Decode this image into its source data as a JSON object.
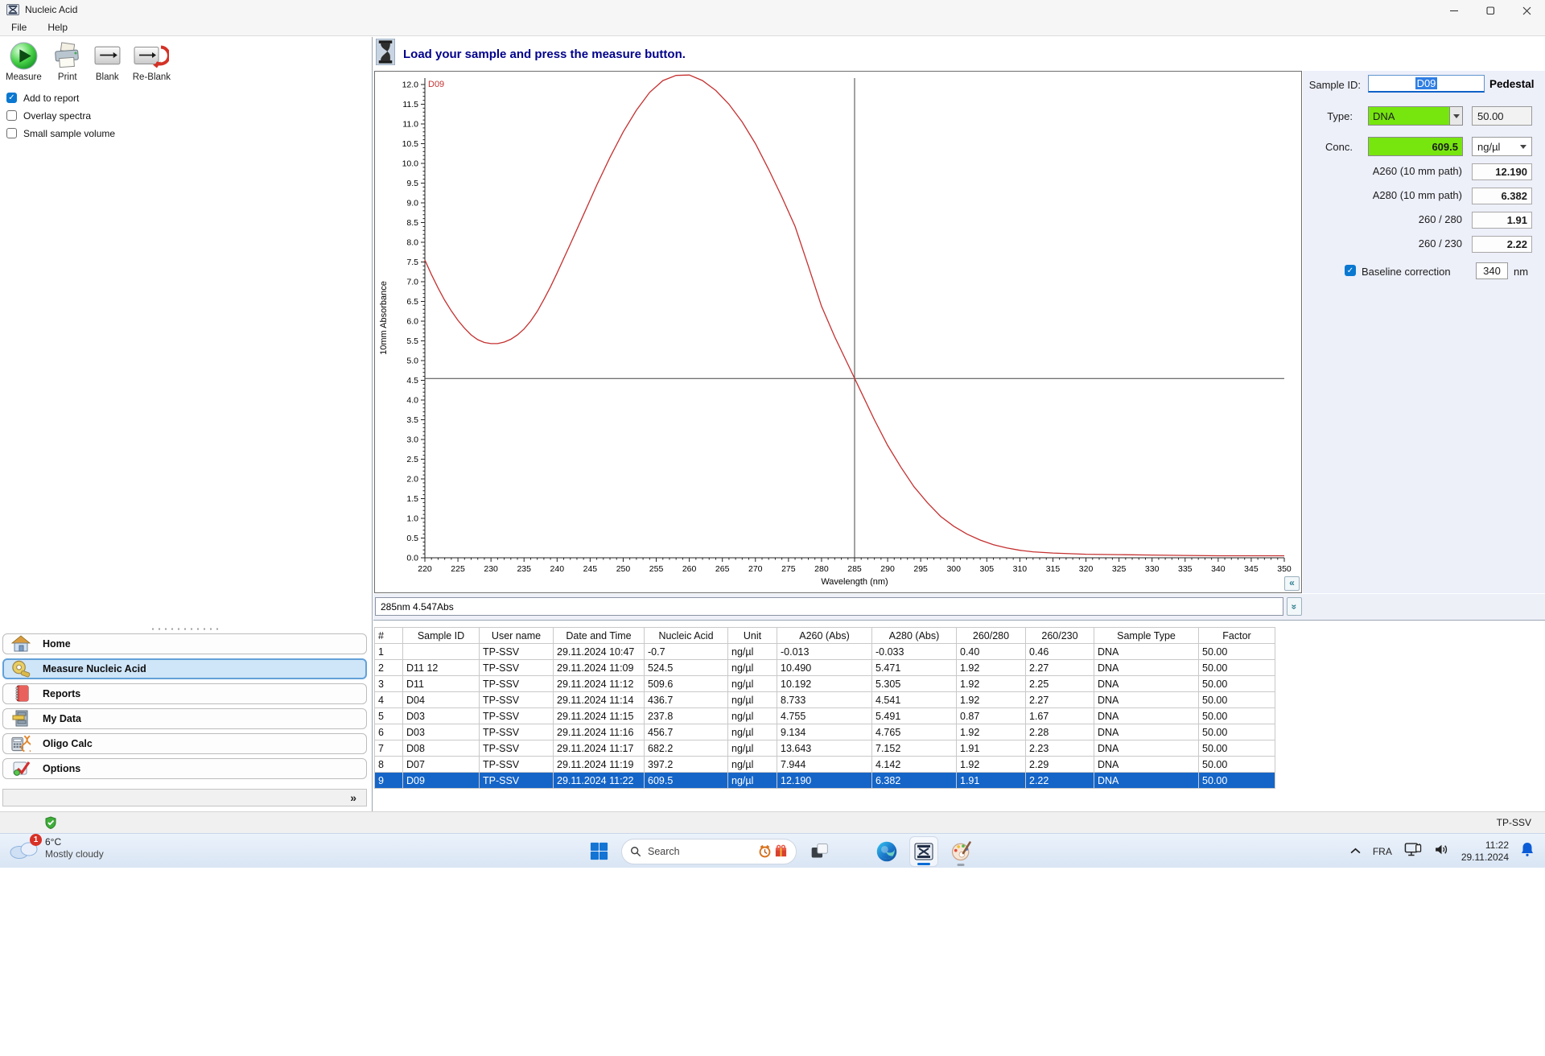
{
  "window": {
    "title": "Nucleic Acid"
  },
  "menu": {
    "items": [
      "File",
      "Help"
    ]
  },
  "toolbar": {
    "buttons": [
      {
        "label": "Measure",
        "icon": "measure-play-icon"
      },
      {
        "label": "Print",
        "icon": "print-icon"
      },
      {
        "label": "Blank",
        "icon": "blank-icon"
      },
      {
        "label": "Re-Blank",
        "icon": "reblank-icon"
      }
    ]
  },
  "report_options": {
    "checkboxes": [
      {
        "label": "Add to report",
        "checked": true
      },
      {
        "label": "Overlay spectra",
        "checked": false
      },
      {
        "label": "Small sample volume",
        "checked": false
      }
    ]
  },
  "message_bar": {
    "icon": "pedestal-icon",
    "text": "Load your sample and press the measure button."
  },
  "sidebar": {
    "items": [
      {
        "label": "Home",
        "icon": "home-icon",
        "selected": false
      },
      {
        "label": "Measure Nucleic Acid",
        "icon": "measure-nucleic-acid-icon",
        "selected": true
      },
      {
        "label": "Reports",
        "icon": "reports-icon",
        "selected": false
      },
      {
        "label": "My Data",
        "icon": "my-data-icon",
        "selected": false
      },
      {
        "label": "Oligo Calc",
        "icon": "oligo-calc-icon",
        "selected": false
      },
      {
        "label": "Options",
        "icon": "options-icon",
        "selected": false
      }
    ],
    "collapse_chevron": "»"
  },
  "chart_data": {
    "type": "line",
    "series_label": "D09",
    "xlabel": "Wavelength (nm)",
    "ylabel": "10mm Absorbance",
    "xlim": [
      220,
      350
    ],
    "ylim": [
      0,
      12
    ],
    "x_tick_step": 5,
    "y_tick_step": 0.5,
    "grid": false,
    "legend_position": "none",
    "line_color": "#c53030",
    "crosshair": {
      "wavelength": 285,
      "absorbance": 4.547
    },
    "points": [
      [
        220,
        7.55
      ],
      [
        221,
        7.18
      ],
      [
        222,
        6.84
      ],
      [
        223,
        6.53
      ],
      [
        224,
        6.26
      ],
      [
        225,
        6.02
      ],
      [
        226,
        5.82
      ],
      [
        227,
        5.65
      ],
      [
        228,
        5.53
      ],
      [
        229,
        5.46
      ],
      [
        230,
        5.43
      ],
      [
        231,
        5.43
      ],
      [
        232,
        5.47
      ],
      [
        233,
        5.54
      ],
      [
        234,
        5.65
      ],
      [
        235,
        5.8
      ],
      [
        236,
        6.0
      ],
      [
        237,
        6.25
      ],
      [
        238,
        6.55
      ],
      [
        239,
        6.87
      ],
      [
        240,
        7.22
      ],
      [
        242,
        7.95
      ],
      [
        244,
        8.7
      ],
      [
        246,
        9.45
      ],
      [
        248,
        10.15
      ],
      [
        250,
        10.8
      ],
      [
        252,
        11.35
      ],
      [
        254,
        11.8
      ],
      [
        256,
        12.1
      ],
      [
        258,
        12.23
      ],
      [
        260,
        12.24
      ],
      [
        262,
        12.1
      ],
      [
        264,
        11.85
      ],
      [
        266,
        11.5
      ],
      [
        268,
        11.05
      ],
      [
        270,
        10.5
      ],
      [
        272,
        9.85
      ],
      [
        274,
        9.15
      ],
      [
        276,
        8.4
      ],
      [
        278,
        7.4
      ],
      [
        280,
        6.38
      ],
      [
        282,
        5.6
      ],
      [
        284,
        4.9
      ],
      [
        286,
        4.2
      ],
      [
        288,
        3.5
      ],
      [
        290,
        2.85
      ],
      [
        292,
        2.3
      ],
      [
        294,
        1.8
      ],
      [
        296,
        1.4
      ],
      [
        298,
        1.05
      ],
      [
        300,
        0.8
      ],
      [
        302,
        0.6
      ],
      [
        304,
        0.45
      ],
      [
        306,
        0.33
      ],
      [
        308,
        0.25
      ],
      [
        310,
        0.19
      ],
      [
        312,
        0.15
      ],
      [
        315,
        0.12
      ],
      [
        320,
        0.09
      ],
      [
        325,
        0.08
      ],
      [
        330,
        0.07
      ],
      [
        335,
        0.06
      ],
      [
        340,
        0.05
      ],
      [
        345,
        0.05
      ],
      [
        350,
        0.05
      ]
    ]
  },
  "cursor_readout": "285nm 4.547Abs",
  "sample_panel": {
    "sample_id_label": "Sample ID:",
    "sample_id_value": "D09",
    "mode_label": "Pedestal",
    "type_label": "Type:",
    "type_value": "DNA",
    "factor_value": "50.00",
    "conc_label": "Conc.",
    "conc_value": "609.5",
    "conc_unit": "ng/µl",
    "rows": [
      {
        "label": "A260 (10 mm path)",
        "value": "12.190"
      },
      {
        "label": "A280 (10 mm path)",
        "value": "6.382"
      },
      {
        "label": "260 / 280",
        "value": "1.91"
      },
      {
        "label": "260 / 230",
        "value": "2.22"
      }
    ],
    "baseline": {
      "label": "Baseline correction",
      "checked": true,
      "value": "340",
      "unit": "nm"
    }
  },
  "results_table": {
    "columns": [
      "#",
      "Sample ID",
      "User name",
      "Date and Time",
      "Nucleic Acid",
      "Unit",
      "A260 (Abs)",
      "A280 (Abs)",
      "260/280",
      "260/230",
      "Sample Type",
      "Factor"
    ],
    "rows": [
      [
        "1",
        "",
        "TP-SSV",
        "29.11.2024 10:47",
        "-0.7",
        "ng/µl",
        "-0.013",
        "-0.033",
        "0.40",
        "0.46",
        "DNA",
        "50.00"
      ],
      [
        "2",
        "D11 12",
        "TP-SSV",
        "29.11.2024 11:09",
        "524.5",
        "ng/µl",
        "10.490",
        "5.471",
        "1.92",
        "2.27",
        "DNA",
        "50.00"
      ],
      [
        "3",
        "D11",
        "TP-SSV",
        "29.11.2024 11:12",
        "509.6",
        "ng/µl",
        "10.192",
        "5.305",
        "1.92",
        "2.25",
        "DNA",
        "50.00"
      ],
      [
        "4",
        "D04",
        "TP-SSV",
        "29.11.2024 11:14",
        "436.7",
        "ng/µl",
        "8.733",
        "4.541",
        "1.92",
        "2.27",
        "DNA",
        "50.00"
      ],
      [
        "5",
        "D03",
        "TP-SSV",
        "29.11.2024 11:15",
        "237.8",
        "ng/µl",
        "4.755",
        "5.491",
        "0.87",
        "1.67",
        "DNA",
        "50.00"
      ],
      [
        "6",
        "D03",
        "TP-SSV",
        "29.11.2024 11:16",
        "456.7",
        "ng/µl",
        "9.134",
        "4.765",
        "1.92",
        "2.28",
        "DNA",
        "50.00"
      ],
      [
        "7",
        "D08",
        "TP-SSV",
        "29.11.2024 11:17",
        "682.2",
        "ng/µl",
        "13.643",
        "7.152",
        "1.91",
        "2.23",
        "DNA",
        "50.00"
      ],
      [
        "8",
        "D07",
        "TP-SSV",
        "29.11.2024 11:19",
        "397.2",
        "ng/µl",
        "7.944",
        "4.142",
        "1.92",
        "2.29",
        "DNA",
        "50.00"
      ],
      [
        "9",
        "D09",
        "TP-SSV",
        "29.11.2024 11:22",
        "609.5",
        "ng/µl",
        "12.190",
        "6.382",
        "1.91",
        "2.22",
        "DNA",
        "50.00"
      ]
    ],
    "selected_row_index": 8
  },
  "app_status": {
    "user": "TP-SSV"
  },
  "taskbar": {
    "weather": {
      "badge": "1",
      "temperature": "6°C",
      "condition": "Mostly cloudy"
    },
    "search": {
      "placeholder": "Search"
    },
    "tray": {
      "language": "FRA",
      "time": "11:22",
      "date": "29.11.2024"
    }
  },
  "colors": {
    "highlight_green": "#76e60e",
    "row_selection_blue": "#1565c8",
    "chart_line_red": "#c53030",
    "message_text_navy": "#00008b"
  }
}
